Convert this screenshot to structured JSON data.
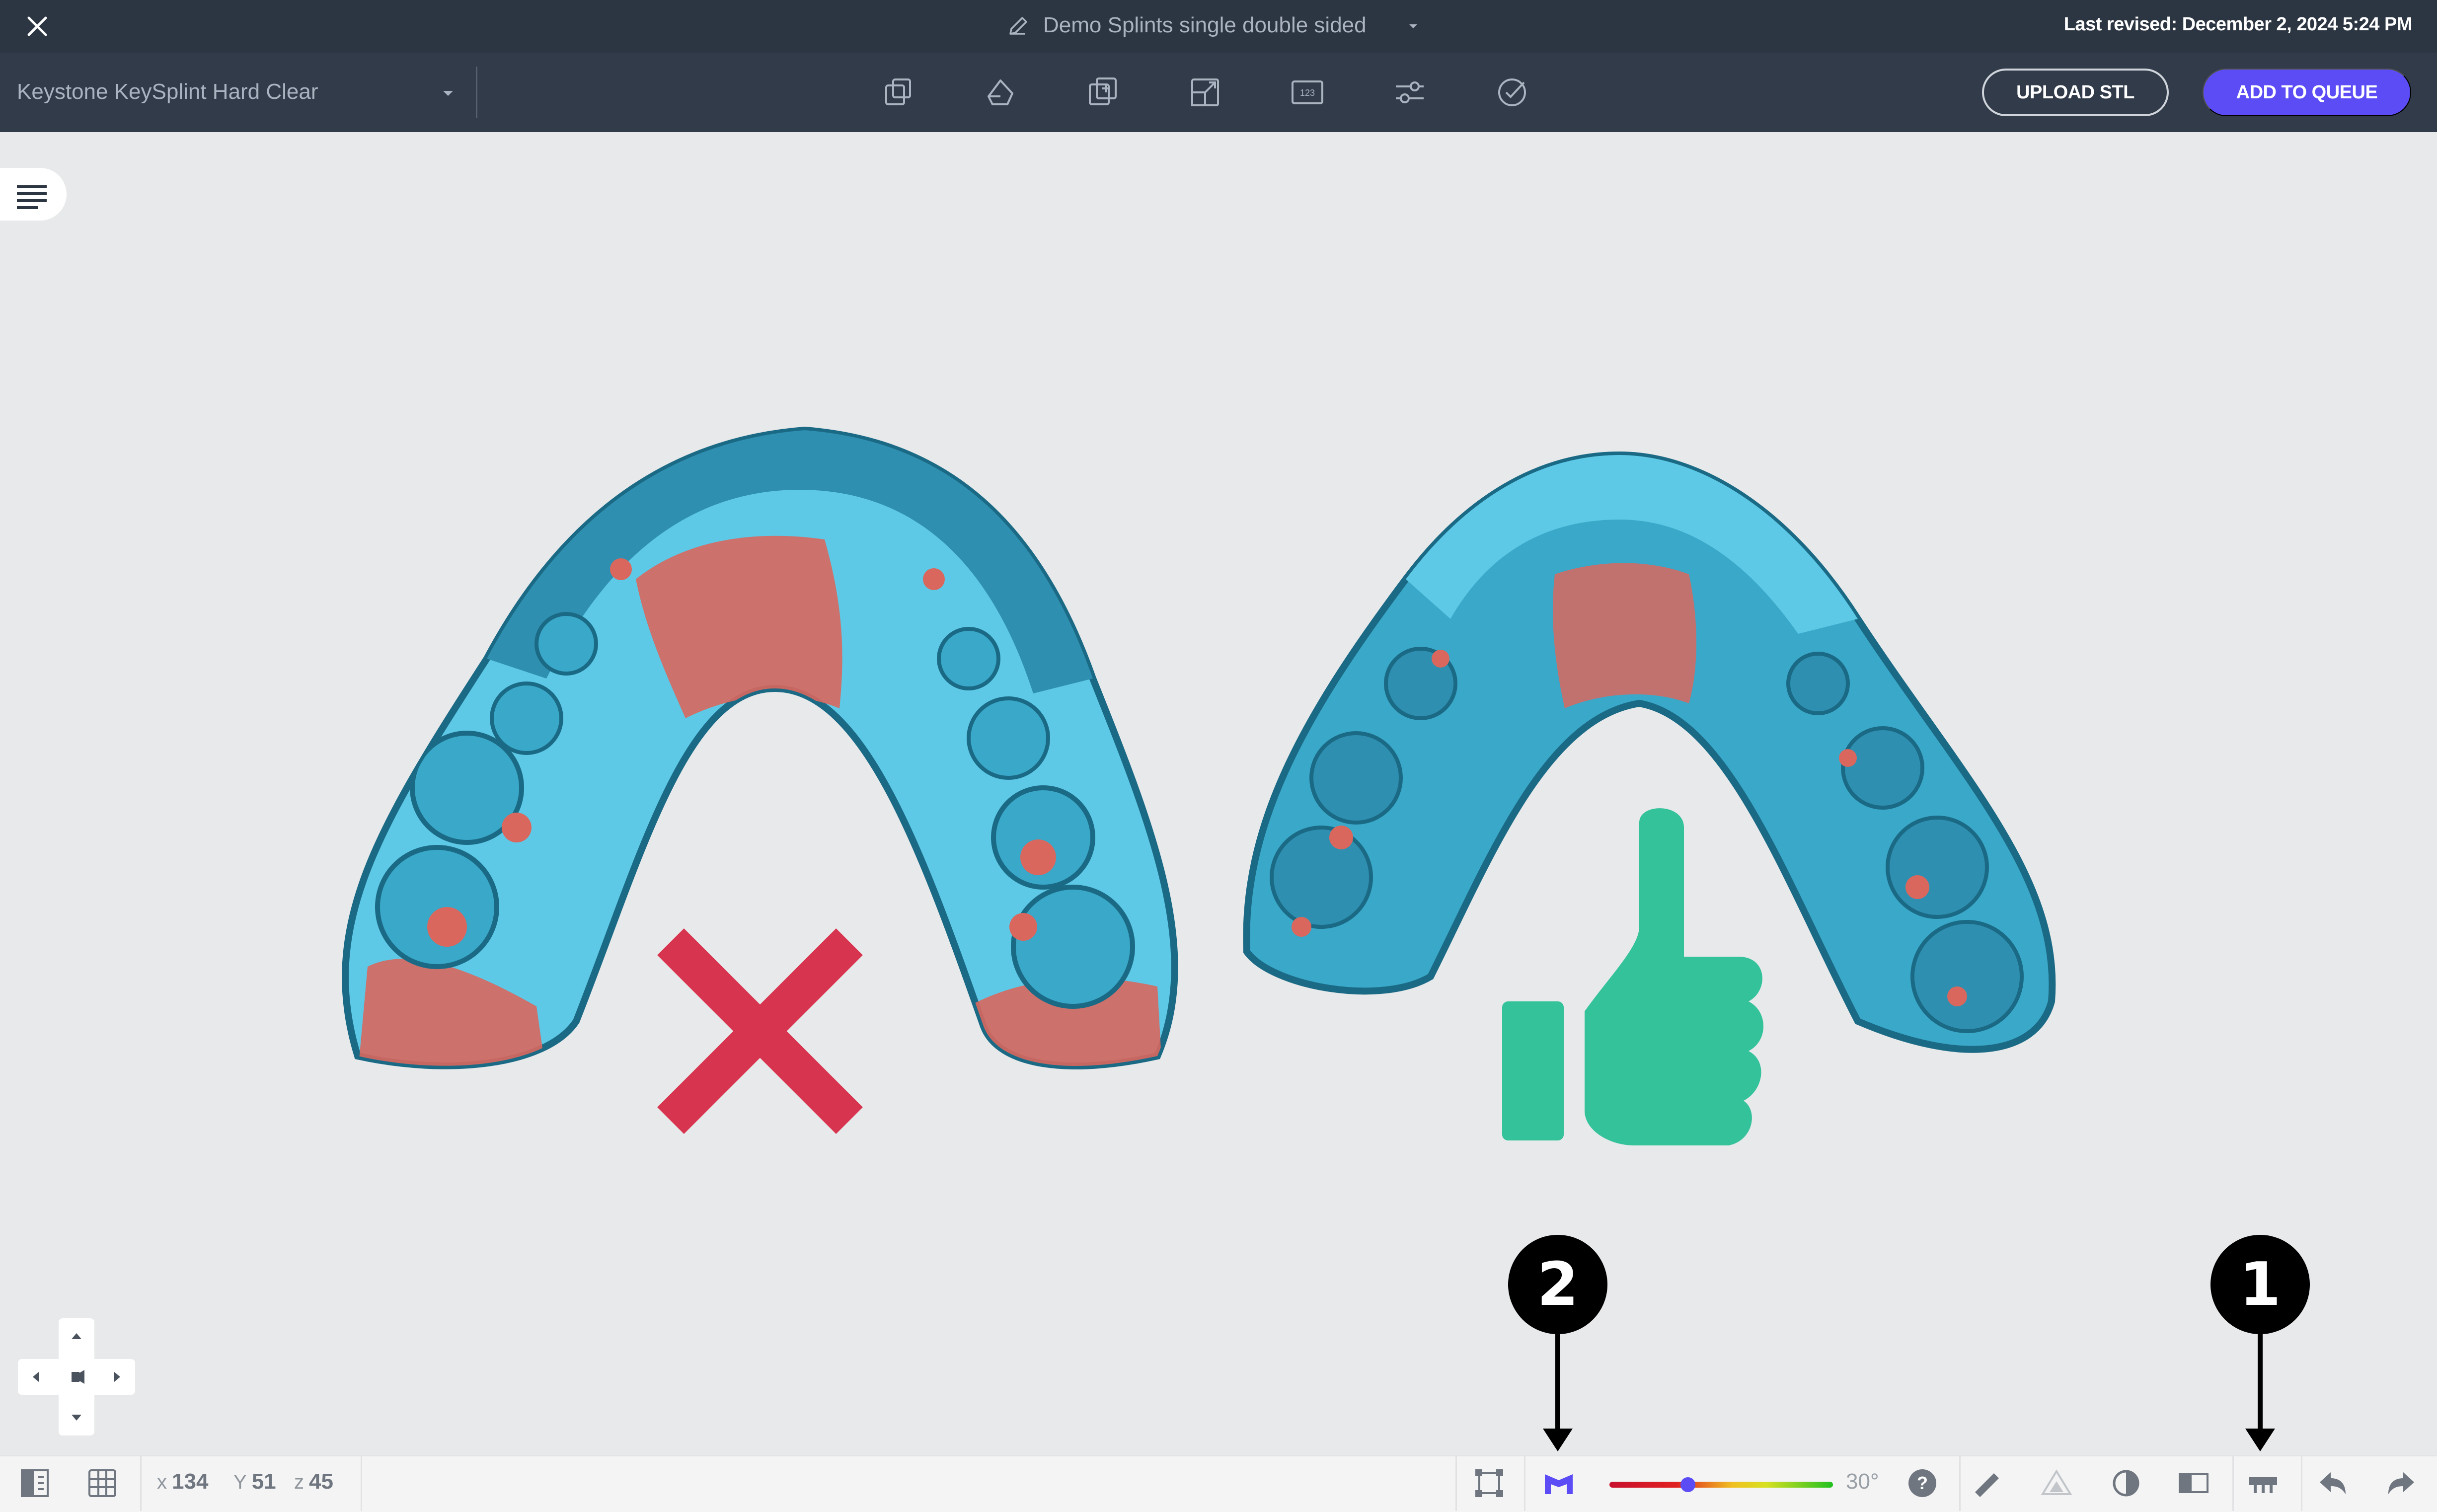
{
  "titlebar": {
    "close_icon": "close-icon",
    "title": "Demo Splints single double sided",
    "last_revised": "Last revised: December 2, 2024 5:24 PM"
  },
  "toolbar": {
    "material": "Keystone KeySplint Hard Clear",
    "tools": [
      "orient-icon",
      "support-icon",
      "duplicate-icon",
      "scale-icon",
      "label-icon",
      "settings-icon",
      "check-icon"
    ],
    "upload_label": "UPLOAD STL",
    "queue_label": "ADD TO QUEUE",
    "accent_color": "#5b4cf5"
  },
  "statusbar": {
    "coords": {
      "x_label": "x",
      "x": "134",
      "y_label": "Y",
      "y": "51",
      "z_label": "z",
      "z": "45"
    },
    "overhang_angle": "30°",
    "overhang_slider_fraction": 0.35
  },
  "callouts": [
    "2",
    "1"
  ],
  "colors": {
    "model_blue": "#5dc9e6",
    "model_shadow": "#1b6a85",
    "overhang_red": "#d9675e",
    "bad_mark": "#d7344f",
    "good_mark": "#33c29a"
  }
}
